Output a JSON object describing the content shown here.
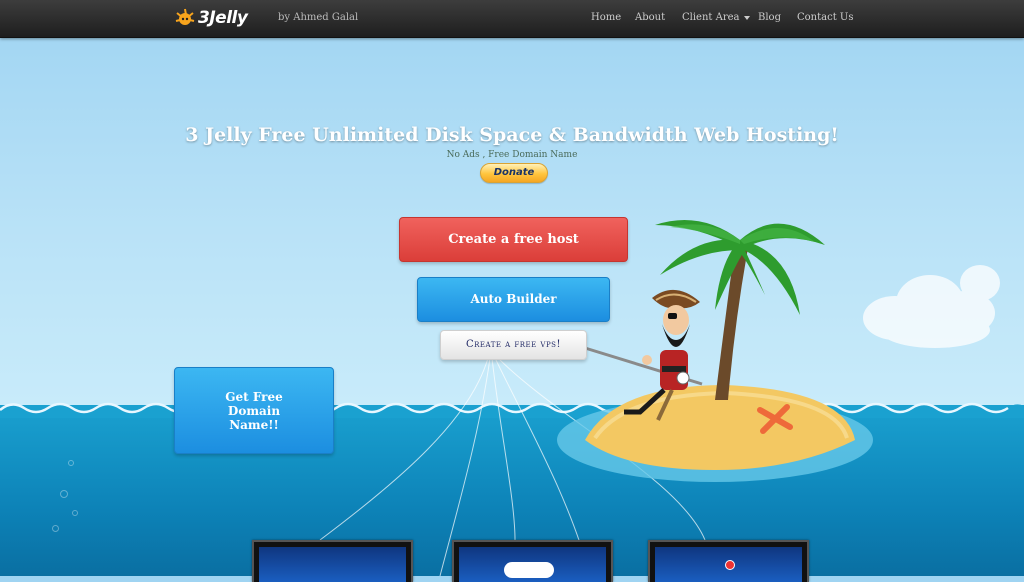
{
  "brand": {
    "name": "3Jelly",
    "number": "3",
    "word": "Jelly"
  },
  "byline": "by Ahmed Galal",
  "nav": {
    "home": "Home",
    "about": "About",
    "client_area": "Client Area",
    "blog": "Blog",
    "contact": "Contact Us"
  },
  "hero": {
    "title": "3 Jelly Free Unlimited Disk Space & Bandwidth Web Hosting!",
    "subtitle": "No Ads , Free Domain Name",
    "donate": "Donate"
  },
  "buttons": {
    "create_host": "Create a free host",
    "auto_builder": "Auto Builder",
    "create_vps": "Create a free vps!",
    "free_domain": "Get Free Domain Name!!"
  },
  "colors": {
    "navbar": "#2b2b2b",
    "sky": "#b9e2f7",
    "ocean": "#1aa1d0",
    "button_red": "#e44d48",
    "button_blue": "#2aa1e8",
    "donate_gold": "#ffc53d"
  },
  "icons": [
    "jelly-logo-icon",
    "caret-down-icon",
    "palm-tree-icon",
    "pirate-icon",
    "island-icon",
    "cloud-icon"
  ]
}
